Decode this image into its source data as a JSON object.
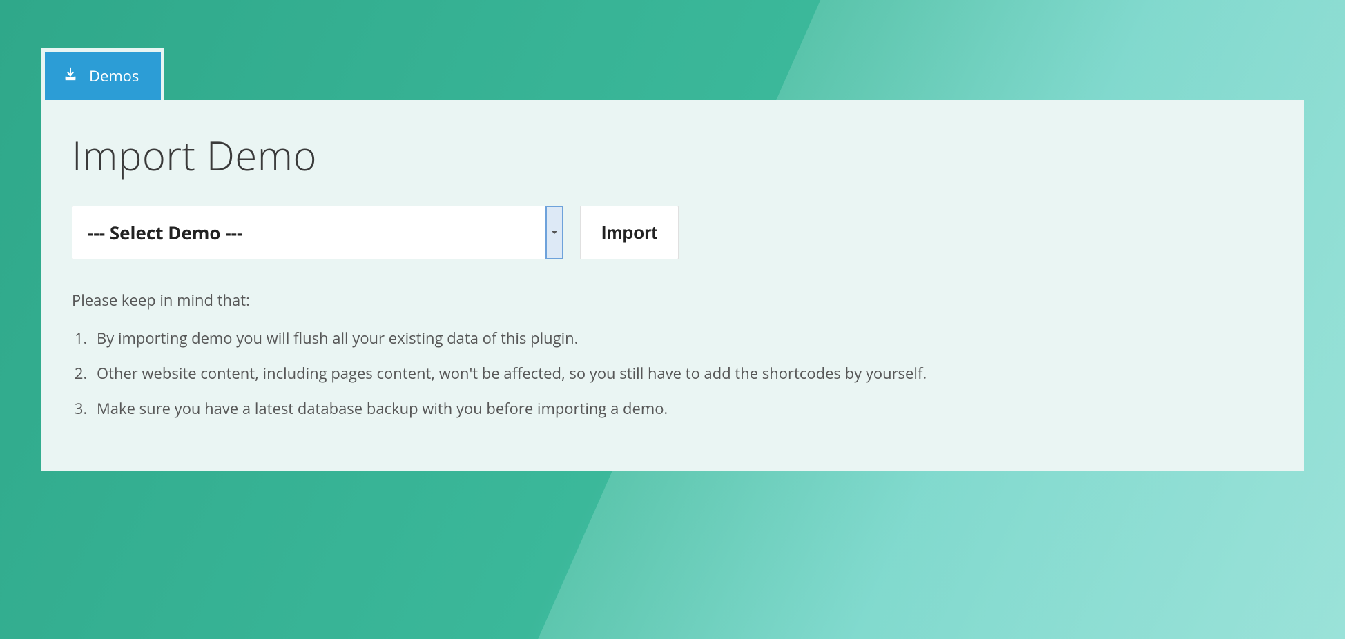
{
  "tab": {
    "label": "Demos"
  },
  "panel": {
    "title": "Import Demo",
    "select_placeholder": "--- Select Demo ---",
    "import_button": "Import",
    "note_intro": "Please keep in mind that:",
    "notes": [
      "By importing demo you will flush all your existing data of this plugin.",
      "Other website content, including pages content, won't be affected, so you still have to add the shortcodes by yourself.",
      "Make sure you have a latest database backup with you before importing a demo."
    ]
  },
  "colors": {
    "tab_bg": "#2c9dd6",
    "panel_bg": "#eaf5f3"
  }
}
